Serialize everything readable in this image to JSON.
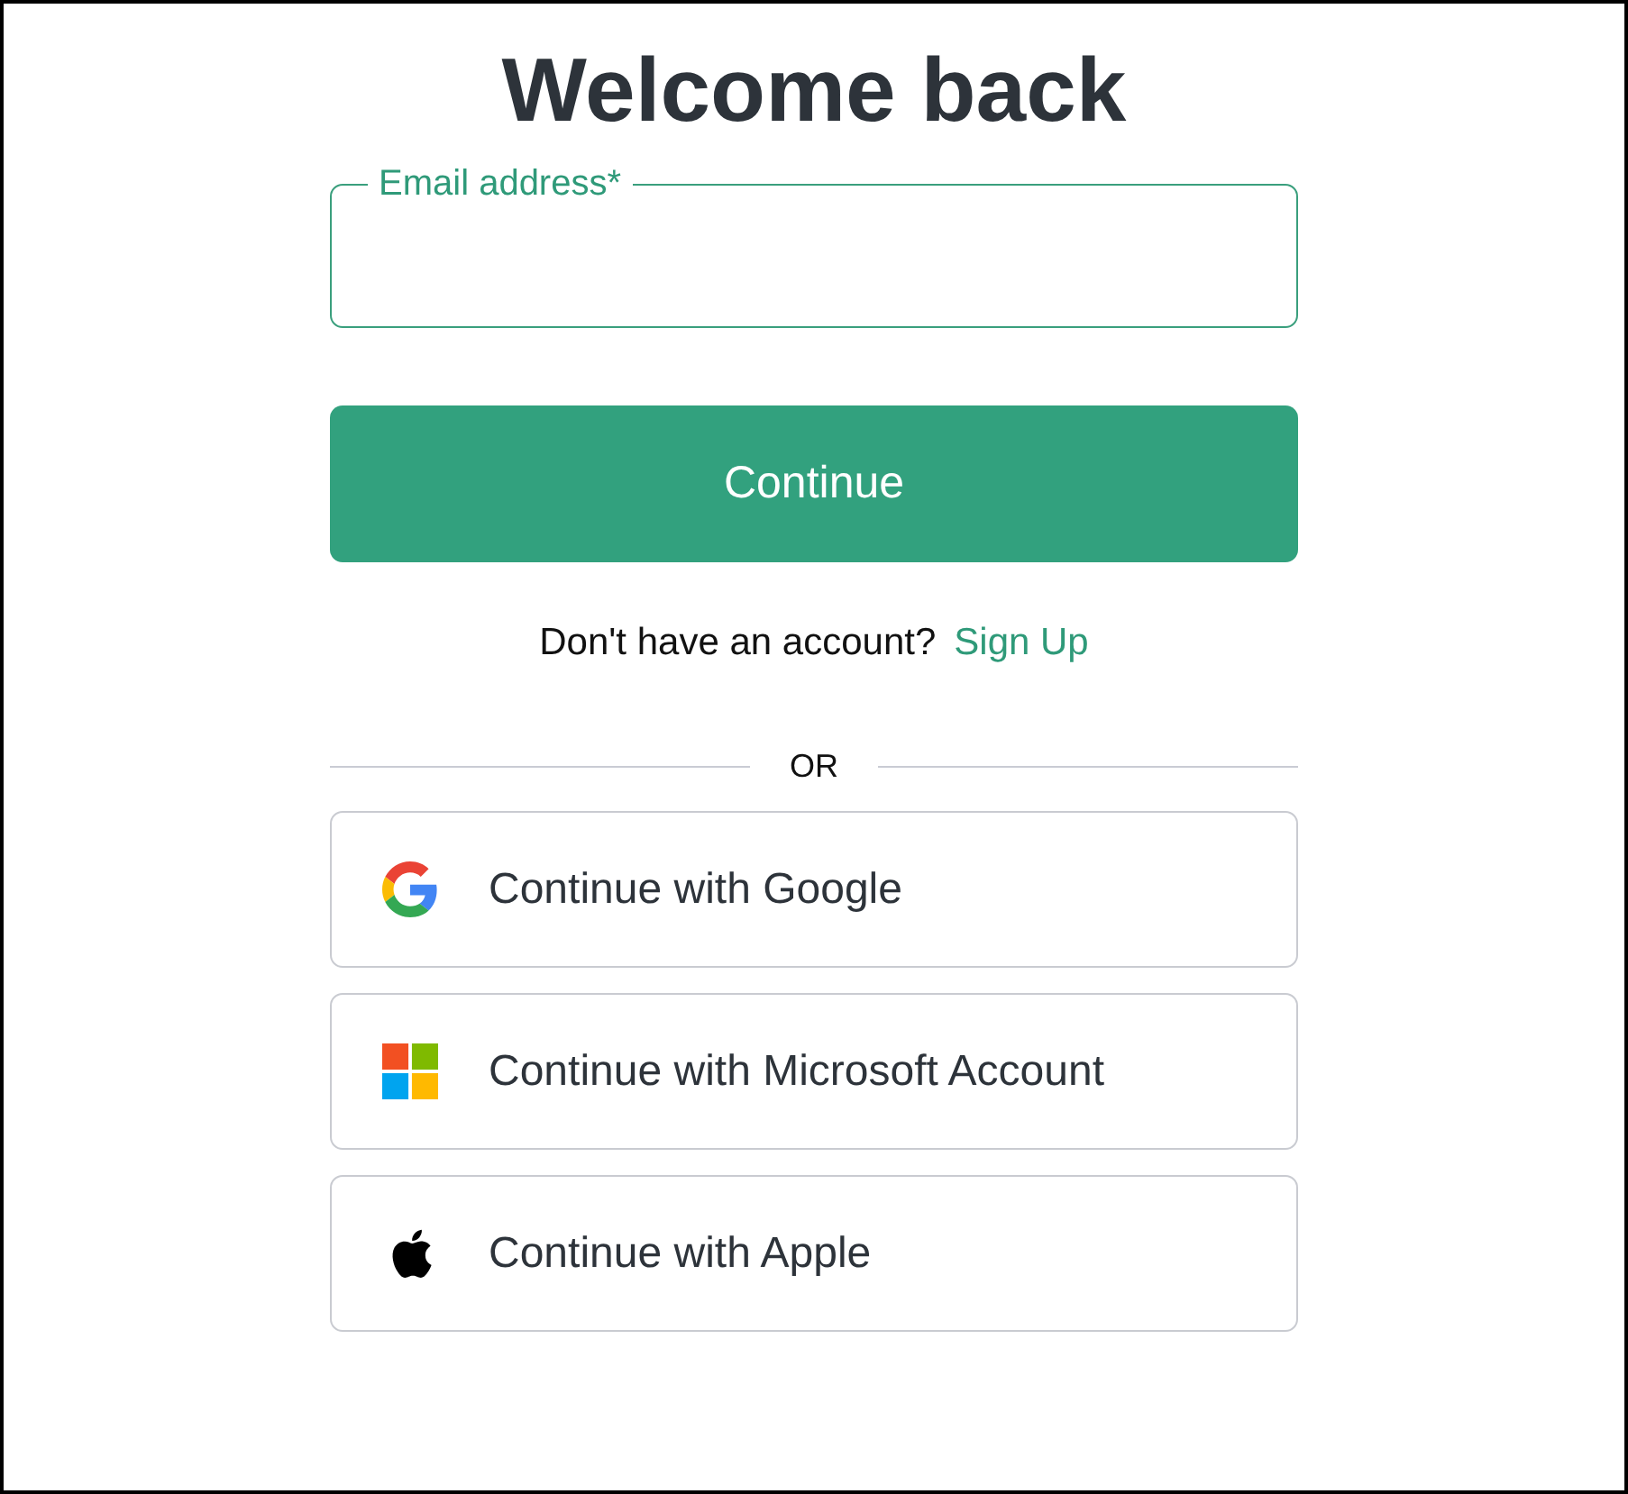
{
  "title": "Welcome back",
  "email_field": {
    "label": "Email address*"
  },
  "continue_button": {
    "label": "Continue"
  },
  "signup_prompt": {
    "text": "Don't have an account?",
    "link": "Sign Up"
  },
  "divider": {
    "label": "OR"
  },
  "social_buttons": [
    {
      "kind": "google",
      "label": "Continue with Google"
    },
    {
      "kind": "microsoft",
      "label": "Continue with Microsoft Account"
    },
    {
      "kind": "apple",
      "label": "Continue with Apple"
    }
  ]
}
